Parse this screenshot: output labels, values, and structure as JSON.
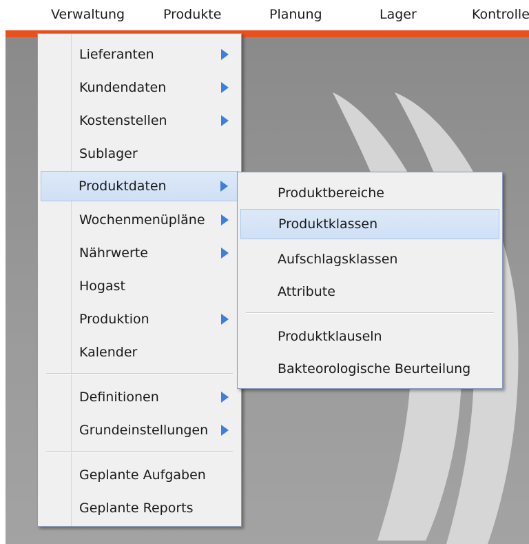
{
  "menubar": {
    "items": [
      "Verwaltung",
      "Produkte",
      "Planung",
      "Lager",
      "Kontrolle"
    ]
  },
  "main_menu": {
    "items": [
      {
        "label": "Lieferanten",
        "has_submenu": true
      },
      {
        "label": "Kundendaten",
        "has_submenu": true
      },
      {
        "label": "Kostenstellen",
        "has_submenu": true
      },
      {
        "label": "Sublager",
        "has_submenu": false
      },
      {
        "label": "Produktdaten",
        "has_submenu": true,
        "highlighted": true
      },
      {
        "label": "Wochenmenüpläne",
        "has_submenu": true
      },
      {
        "label": "Nährwerte",
        "has_submenu": true
      },
      {
        "label": "Hogast",
        "has_submenu": false
      },
      {
        "label": "Produktion",
        "has_submenu": true
      },
      {
        "label": "Kalender",
        "has_submenu": false
      },
      {
        "label": "Definitionen",
        "has_submenu": true
      },
      {
        "label": "Grundeinstellungen",
        "has_submenu": true
      },
      {
        "label": "Geplante Aufgaben",
        "has_submenu": false
      },
      {
        "label": "Geplante Reports",
        "has_submenu": false
      }
    ]
  },
  "sub_menu": {
    "items": [
      {
        "label": "Produktbereiche"
      },
      {
        "label": "Produktklassen",
        "highlighted": true
      },
      {
        "label": "Aufschlagsklassen"
      },
      {
        "label": "Attribute"
      },
      {
        "label": "Produktklauseln"
      },
      {
        "label": "Bakteorologische Beurteilung"
      }
    ]
  },
  "colors": {
    "accent": "#e8501e",
    "arrow": "#3d7fe0",
    "highlight": "#d4e4f7",
    "menu_bg": "#f0f0f0"
  }
}
